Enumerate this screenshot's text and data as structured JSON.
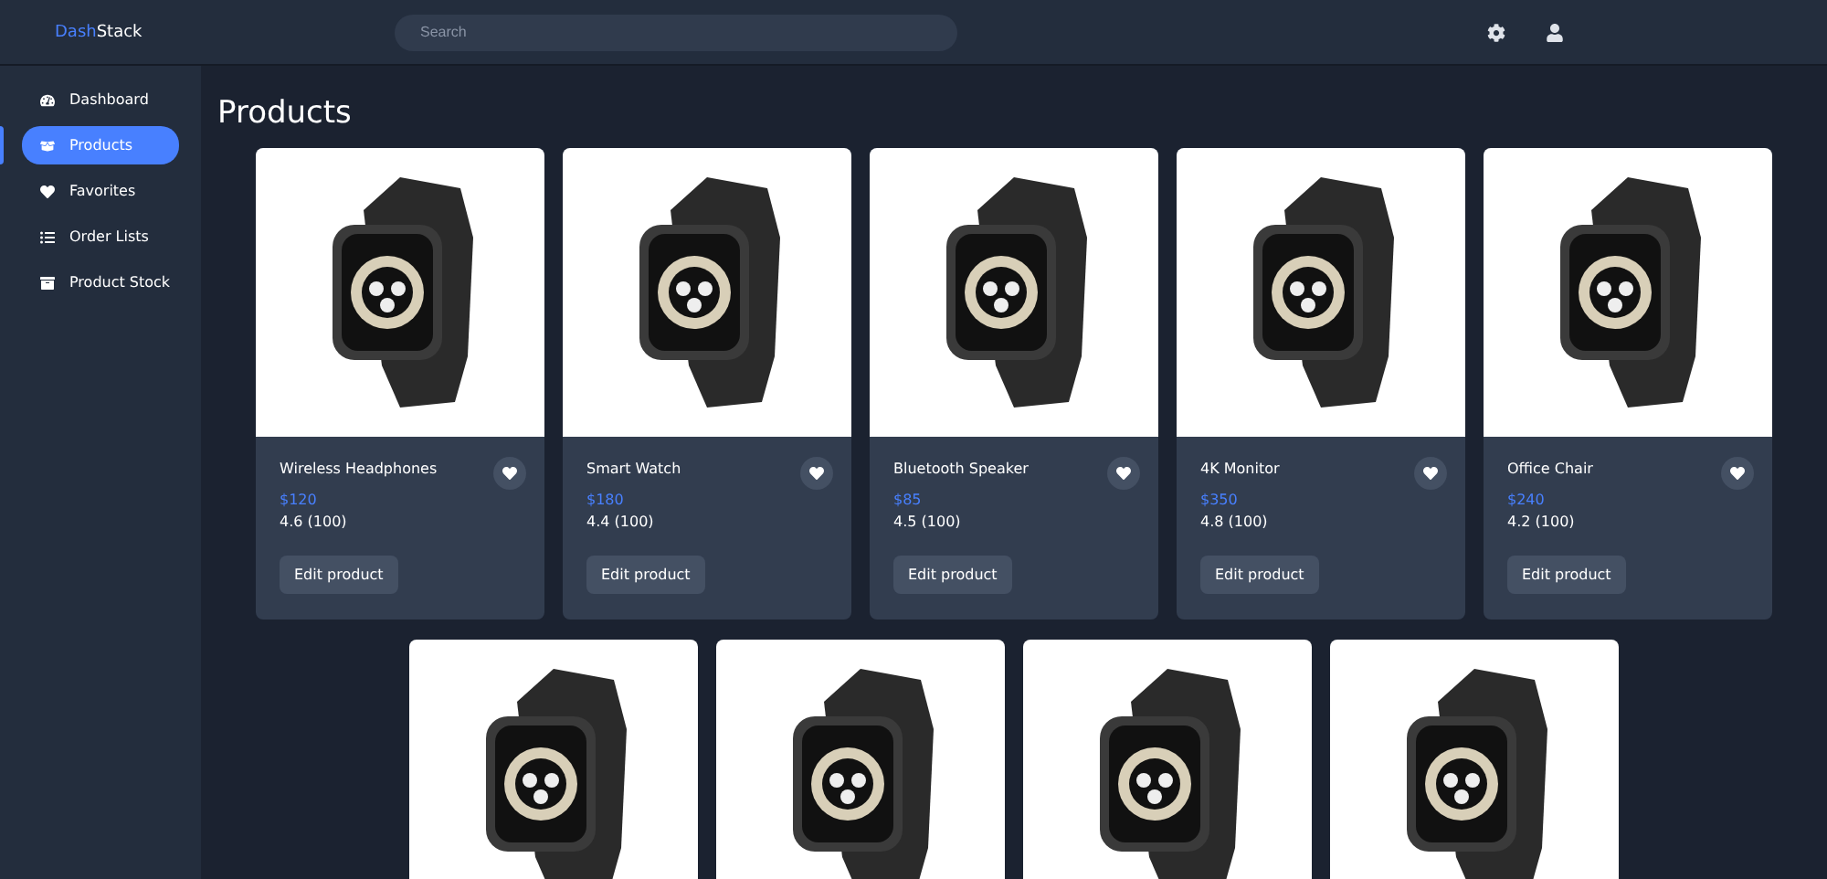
{
  "brand": {
    "part_1": "Dash",
    "part_2": "Stack"
  },
  "search": {
    "placeholder": "Search"
  },
  "sidebar": {
    "items": [
      {
        "label": "Dashboard",
        "selected": false
      },
      {
        "label": "Products",
        "selected": true
      },
      {
        "label": "Favorites",
        "selected": false
      },
      {
        "label": "Order Lists",
        "selected": false
      },
      {
        "label": "Product Stock",
        "selected": false
      }
    ]
  },
  "page_title": "Products",
  "products": [
    {
      "kind": "full",
      "name": "Wireless Headphones",
      "price": "$120",
      "rating": "4.6 (100)",
      "button": "Edit product"
    },
    {
      "kind": "full",
      "name": "Smart Watch",
      "price": "$180",
      "rating": "4.4 (100)",
      "button": "Edit product"
    },
    {
      "kind": "full",
      "name": "Bluetooth Speaker",
      "price": "$85",
      "rating": "4.5 (100)",
      "button": "Edit product"
    },
    {
      "kind": "full",
      "name": "4K Monitor",
      "price": "$350",
      "rating": "4.8 (100)",
      "button": "Edit product"
    },
    {
      "kind": "full",
      "name": "Office Chair",
      "price": "$240",
      "rating": "4.2 (100)",
      "button": "Edit product"
    },
    {
      "kind": "image_only"
    },
    {
      "kind": "image_only"
    },
    {
      "kind": "image_only"
    },
    {
      "kind": "image_only"
    }
  ]
}
